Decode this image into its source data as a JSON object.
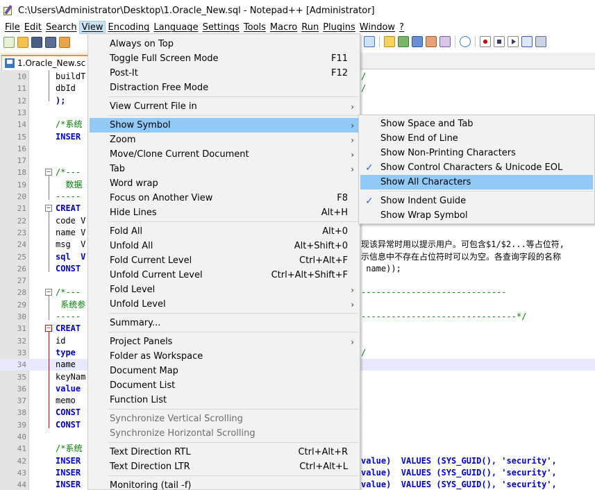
{
  "window": {
    "title": "C:\\Users\\Administrator\\Desktop\\1.Oracle_New.sql - Notepad++ [Administrator]"
  },
  "menubar": [
    "File",
    "Edit",
    "Search",
    "View",
    "Encoding",
    "Language",
    "Settings",
    "Tools",
    "Macro",
    "Run",
    "Plugins",
    "Window",
    "?"
  ],
  "tab": {
    "label": "1.Oracle_New.sc"
  },
  "editor": {
    "lines": [
      {
        "n": "10",
        "code": "buildT",
        "right": "/"
      },
      {
        "n": "11",
        "code": "dbId",
        "right": "/"
      },
      {
        "n": "12",
        "code": ");"
      },
      {
        "n": "13",
        "code": ""
      },
      {
        "n": "14",
        "code": "/*系统"
      },
      {
        "n": "15",
        "code": "INSER"
      },
      {
        "n": "16",
        "code": ""
      },
      {
        "n": "17",
        "code": ""
      },
      {
        "n": "18",
        "code": "/*---"
      },
      {
        "n": "19",
        "code": "  数据"
      },
      {
        "n": "20",
        "code": "-----"
      },
      {
        "n": "21",
        "code": "CREAT"
      },
      {
        "n": "22",
        "code": "code V"
      },
      {
        "n": "23",
        "code": "name V"
      },
      {
        "n": "24",
        "code": "msg  V",
        "right": "现该异常时用以提示用户。可包含$1/$2...等占位符,"
      },
      {
        "n": "25",
        "code": "sql  V",
        "right": "示信息中不存在占位符时可以为空。各查询字段的名称"
      },
      {
        "n": "26",
        "code": "CONST",
        "right": " name));"
      },
      {
        "n": "27",
        "code": ""
      },
      {
        "n": "28",
        "code": "/*---",
        "right": "-----------------------------"
      },
      {
        "n": "29",
        "code": " 系统参"
      },
      {
        "n": "30",
        "code": "-----",
        "right": "-------------------------------*/"
      },
      {
        "n": "31",
        "code": "CREAT"
      },
      {
        "n": "32",
        "code": "id"
      },
      {
        "n": "33",
        "code": "type",
        "right": "/"
      },
      {
        "n": "34",
        "code": "name"
      },
      {
        "n": "35",
        "code": "keyNam"
      },
      {
        "n": "36",
        "code": "value"
      },
      {
        "n": "37",
        "code": "memo"
      },
      {
        "n": "38",
        "code": "CONST"
      },
      {
        "n": "39",
        "code": "CONST"
      },
      {
        "n": "40",
        "code": ""
      },
      {
        "n": "41",
        "code": "/*系统"
      },
      {
        "n": "42",
        "code": "INSER",
        "right": "value)  VALUES (SYS_GUID(), 'security',"
      },
      {
        "n": "43",
        "code": "INSER",
        "right": "value)  VALUES (SYS_GUID(), 'security',"
      },
      {
        "n": "44",
        "code": "INSER",
        "right": "value)  VALUES (SYS_GUID(), 'security',"
      }
    ]
  },
  "view_menu": {
    "items": [
      {
        "label": "Always on Top"
      },
      {
        "label": "Toggle Full Screen Mode",
        "shortcut": "F11"
      },
      {
        "label": "Post-It",
        "shortcut": "F12"
      },
      {
        "label": "Distraction Free Mode"
      },
      {
        "label": "View Current File in",
        "submenu": true
      },
      {
        "label": "Show Symbol",
        "submenu": true,
        "hover": true
      },
      {
        "label": "Zoom",
        "submenu": true
      },
      {
        "label": "Move/Clone Current Document",
        "submenu": true
      },
      {
        "label": "Tab",
        "submenu": true
      },
      {
        "label": "Word wrap"
      },
      {
        "label": "Focus on Another View",
        "shortcut": "F8"
      },
      {
        "label": "Hide Lines",
        "shortcut": "Alt+H"
      },
      {
        "label": "Fold All",
        "shortcut": "Alt+0"
      },
      {
        "label": "Unfold All",
        "shortcut": "Alt+Shift+0"
      },
      {
        "label": "Fold Current Level",
        "shortcut": "Ctrl+Alt+F"
      },
      {
        "label": "Unfold Current Level",
        "shortcut": "Ctrl+Alt+Shift+F"
      },
      {
        "label": "Fold Level",
        "submenu": true
      },
      {
        "label": "Unfold Level",
        "submenu": true
      },
      {
        "label": "Summary..."
      },
      {
        "label": "Project Panels",
        "submenu": true
      },
      {
        "label": "Folder as Workspace"
      },
      {
        "label": "Document Map"
      },
      {
        "label": "Document List"
      },
      {
        "label": "Function List"
      },
      {
        "label": "Synchronize Vertical Scrolling",
        "disabled": true
      },
      {
        "label": "Synchronize Horizontal Scrolling",
        "disabled": true
      },
      {
        "label": "Text Direction RTL",
        "shortcut": "Ctrl+Alt+R"
      },
      {
        "label": "Text Direction LTR",
        "shortcut": "Ctrl+Alt+L"
      },
      {
        "label": "Monitoring (tail -f)"
      }
    ]
  },
  "show_symbol_menu": {
    "items": [
      {
        "label": "Show Space and Tab"
      },
      {
        "label": "Show End of Line"
      },
      {
        "label": "Show Non-Printing Characters"
      },
      {
        "label": "Show Control Characters & Unicode EOL",
        "checked": true
      },
      {
        "label": "Show All Characters",
        "hover": true
      },
      {
        "label": "Show Indent Guide",
        "checked": true
      },
      {
        "label": "Show Wrap Symbol"
      }
    ]
  },
  "colors": {
    "menu_highlight": "#91c9f7",
    "menubar_active": "#cce4f7",
    "tab_accent": "#fa8c1e"
  }
}
